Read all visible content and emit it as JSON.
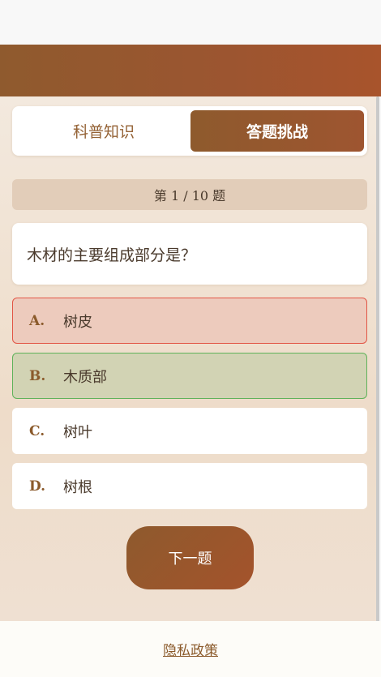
{
  "tabs": [
    {
      "label": "科普知识",
      "active": false
    },
    {
      "label": "答题挑战",
      "active": true
    }
  ],
  "quiz": {
    "progress": "第 1 / 10 题",
    "question": "木材的主要组成部分是？",
    "options": [
      {
        "letter": "A.",
        "text": "树皮",
        "state": "wrong"
      },
      {
        "letter": "B.",
        "text": "木质部",
        "state": "correct"
      },
      {
        "letter": "C.",
        "text": "树叶",
        "state": "none"
      },
      {
        "letter": "D.",
        "text": "树根",
        "state": "none"
      }
    ],
    "next_label": "下一题"
  },
  "footer": {
    "privacy_label": "隐私政策"
  },
  "colors": {
    "brand": "#8e5a2d",
    "wrong_bg": "#edcbbd",
    "wrong_border": "#e25545",
    "correct_bg": "#d2d3b4",
    "correct_border": "#5fb25a"
  }
}
